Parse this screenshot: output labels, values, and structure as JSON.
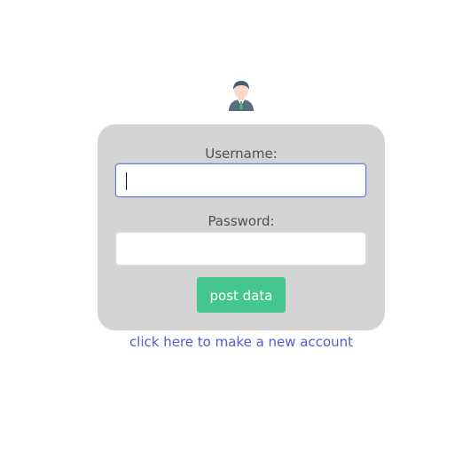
{
  "login_form": {
    "username_label": "Username:",
    "username_value": "",
    "password_label": "Password:",
    "password_value": "",
    "submit_label": "post data",
    "signup_link": "click here to make a new account"
  },
  "icons": {
    "header_icon": "user-avatar-icon"
  },
  "colors": {
    "card_background": "#d4d4d4",
    "button": "#45c68c",
    "link": "#4a5fd0",
    "focus_border": "#6b7fd7"
  }
}
